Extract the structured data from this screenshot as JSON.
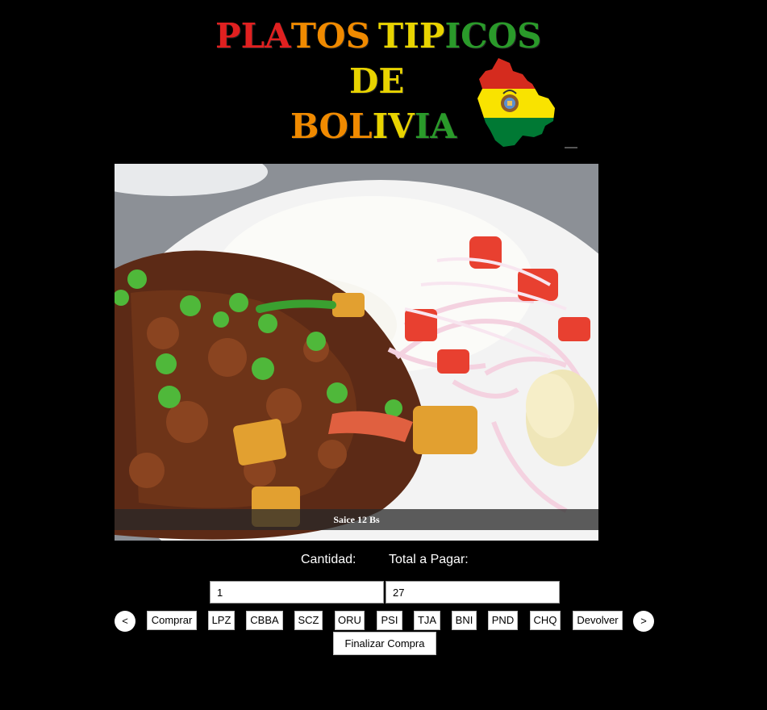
{
  "header": {
    "title_line1": "PLATOS TIPICOS",
    "title_line2": "DE",
    "title_line3": "BOLIVIA",
    "colors": {
      "red": "#e02020",
      "orange": "#f08a00",
      "yellow": "#e8d300",
      "green": "#2a9a2a"
    }
  },
  "slide": {
    "caption": "Saice 12 Bs",
    "image": "saice-dish-photo"
  },
  "order": {
    "quantity_label": "Cantidad:",
    "total_label": "Total a Pagar:",
    "quantity_value": "1",
    "total_value": "27"
  },
  "controls": {
    "prev": "<",
    "next": ">",
    "buy": "Comprar",
    "regions": [
      "LPZ",
      "CBBA",
      "SCZ",
      "ORU",
      "PSI",
      "TJA",
      "BNI",
      "PND",
      "CHQ"
    ],
    "return": "Devolver",
    "finish": "Finalizar Compra"
  }
}
